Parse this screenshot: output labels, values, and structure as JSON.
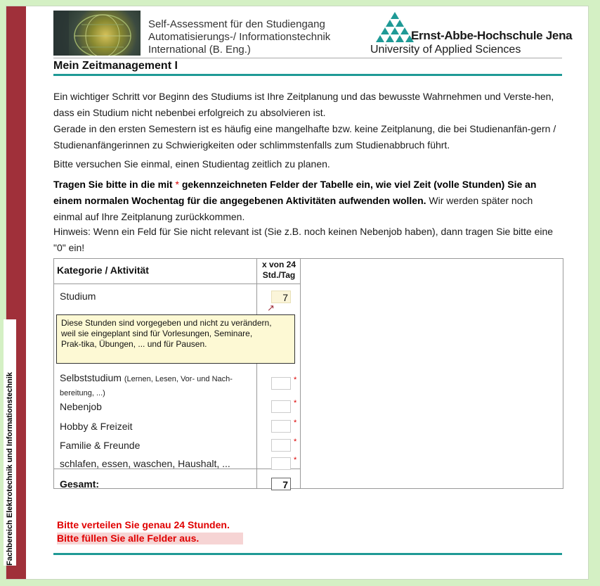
{
  "side_label": "Fachbereich Elektrotechnik und Informationstechnik",
  "header": {
    "title_lines": [
      "Self-Assessment für den Studiengang",
      "Automatisierungs-/ Informationstechnik",
      "International (B. Eng.)"
    ],
    "logo_name": "Ernst-Abbe-Hochschule Jena",
    "logo_sub": "University of Applied Sciences"
  },
  "section_title": "Mein Zeitmanagement I",
  "paragraphs": {
    "p1": "Ein wichtiger Schritt vor Beginn des Studiums ist Ihre Zeitplanung und das bewusste Wahrnehmen und Verste-hen, dass ein Studium nicht nebenbei erfolgreich zu absolvieren ist.",
    "p2": "Gerade in den ersten Semestern ist es häufig eine mangelhafte bzw. keine Zeitplanung, die bei Studienanfän-gern / Studienanfängerinnen zu Schwierigkeiten oder schlimmstenfalls zum Studienabbruch führt.",
    "p3": "Bitte versuchen Sie einmal, einen Studientag zeitlich zu planen.",
    "p4_bold_a": "Tragen Sie bitte in die mit",
    "p4_star": "*",
    "p4_bold_b": "gekennzeichneten Felder der Tabelle ein, wie viel Zeit (volle Stunden) Sie an einem normalen Wochentag für die angegebenen Aktivitäten aufwenden wollen.",
    "p4_rest": "Wir werden später noch einmal auf Ihre Zeitplanung zurückkommen.",
    "p5": "Hinweis: Wenn ein Feld für Sie nicht relevant ist (Sie z.B. noch keinen Nebenjob haben), dann tragen Sie bitte eine \"0\" ein!"
  },
  "table": {
    "col_category": "Kategorie / Aktivität",
    "col_hours_line1": "x von 24",
    "col_hours_line2": "Std./Tag",
    "rows": [
      {
        "label": "Studium",
        "value": "7"
      },
      {
        "label": "Selbststudium",
        "label_small": "(Lernen, Lesen, Vor- und Nach-bereitung, ...)",
        "value": ""
      },
      {
        "label": "Nebenjob",
        "value": ""
      },
      {
        "label": "Hobby & Freizeit",
        "value": ""
      },
      {
        "label": "Familie & Freunde",
        "value": ""
      },
      {
        "label": "schlafen, essen, waschen, Haushalt, ...",
        "value": ""
      }
    ],
    "required_mark": "*",
    "tooltip_lines": [
      "Diese Stunden sind vorgegeben und nicht zu verändern,",
      "weil sie eingeplant sind für Vorlesungen, Seminare,",
      "Prak-tika, Übungen, ... und für Pausen."
    ],
    "total_label": "Gesamt:",
    "total_value": "7"
  },
  "warnings": {
    "w1": "Bitte verteilen Sie genau 24 Stunden.",
    "w2": "Bitte füllen Sie alle Felder aus."
  },
  "colors": {
    "accent_teal": "#1f9a96",
    "side_band": "#a0303a",
    "warning_red": "#e00000"
  }
}
